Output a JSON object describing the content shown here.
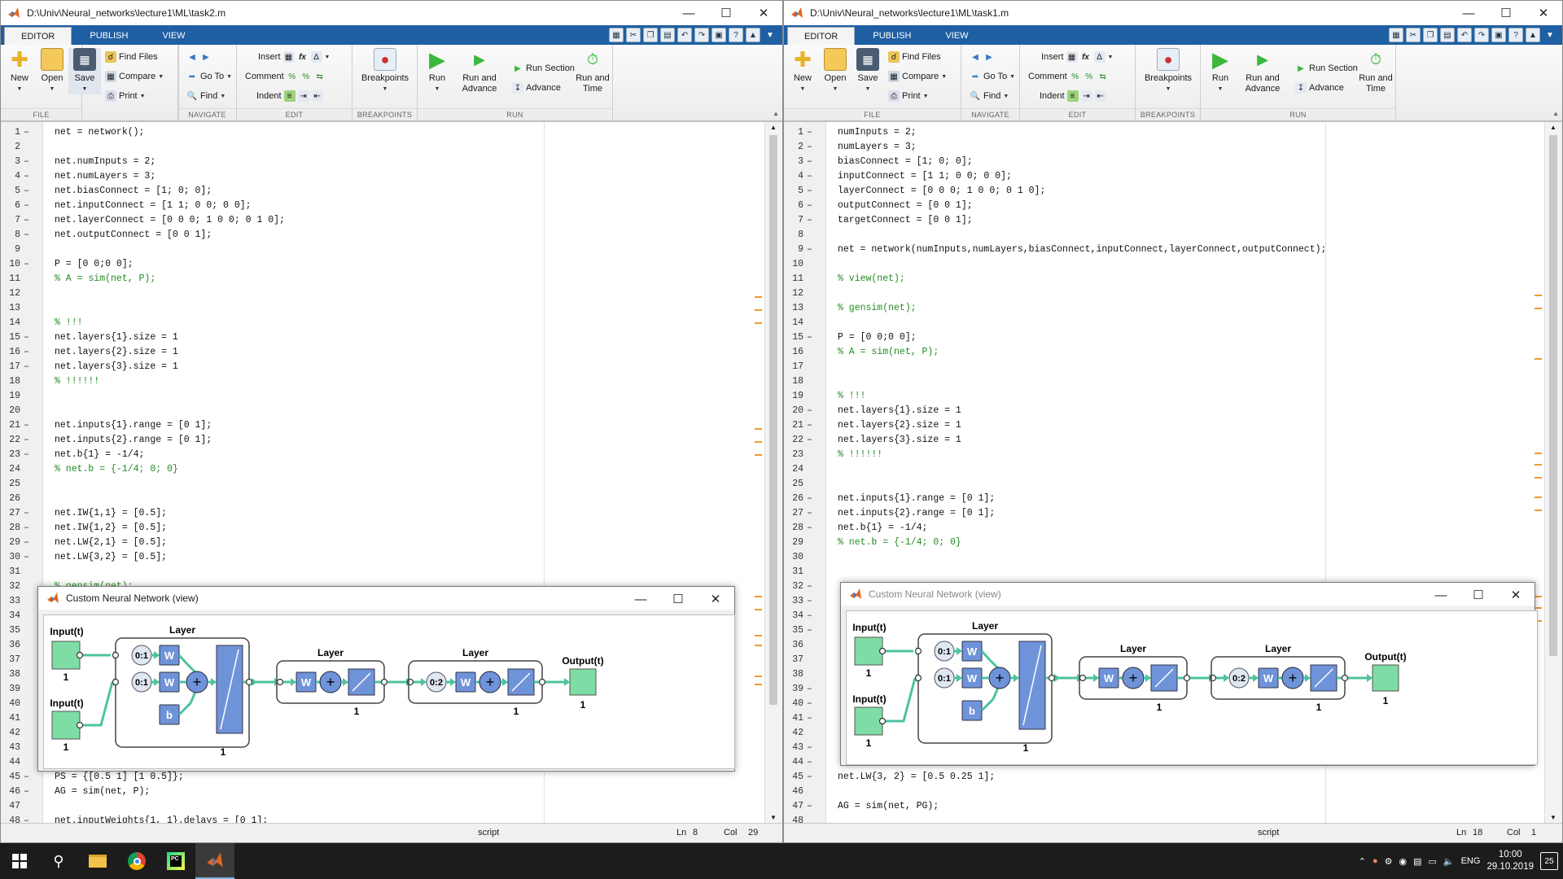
{
  "left": {
    "title": "D:\\Univ\\Neural_networks\\lecture1\\ML\\task2.m",
    "status": {
      "mode": "script",
      "ln_label": "Ln",
      "ln": "8",
      "col_label": "Col",
      "col": "29"
    },
    "lines": [
      {
        "n": "1",
        "d": "–",
        "t": "net = network();",
        "c": false
      },
      {
        "n": "2",
        "d": "",
        "t": "",
        "c": false
      },
      {
        "n": "3",
        "d": "–",
        "t": "net.numInputs = 2;",
        "c": false
      },
      {
        "n": "4",
        "d": "–",
        "t": "net.numLayers = 3;",
        "c": false
      },
      {
        "n": "5",
        "d": "–",
        "t": "net.biasConnect = [1; 0; 0];",
        "c": false
      },
      {
        "n": "6",
        "d": "–",
        "t": "net.inputConnect = [1 1; 0 0; 0 0];",
        "c": false
      },
      {
        "n": "7",
        "d": "–",
        "t": "net.layerConnect = [0 0 0; 1 0 0; 0 1 0];",
        "c": false
      },
      {
        "n": "8",
        "d": "–",
        "t": "net.outputConnect = [0 0 1];",
        "c": false
      },
      {
        "n": "9",
        "d": "",
        "t": "",
        "c": false
      },
      {
        "n": "10",
        "d": "–",
        "t": "P = [0 0;0 0];",
        "c": false
      },
      {
        "n": "11",
        "d": "",
        "t": "% A = sim(net, P);",
        "c": true
      },
      {
        "n": "12",
        "d": "",
        "t": "",
        "c": false
      },
      {
        "n": "13",
        "d": "",
        "t": "",
        "c": false
      },
      {
        "n": "14",
        "d": "",
        "t": "% !!!",
        "c": true
      },
      {
        "n": "15",
        "d": "–",
        "t": "net.layers{1}.size = 1",
        "c": false
      },
      {
        "n": "16",
        "d": "–",
        "t": "net.layers{2}.size = 1",
        "c": false
      },
      {
        "n": "17",
        "d": "–",
        "t": "net.layers{3}.size = 1",
        "c": false
      },
      {
        "n": "18",
        "d": "",
        "t": "% !!!!!!",
        "c": true
      },
      {
        "n": "19",
        "d": "",
        "t": "",
        "c": false
      },
      {
        "n": "20",
        "d": "",
        "t": "",
        "c": false
      },
      {
        "n": "21",
        "d": "–",
        "t": "net.inputs{1}.range = [0 1];",
        "c": false
      },
      {
        "n": "22",
        "d": "–",
        "t": "net.inputs{2}.range = [0 1];",
        "c": false
      },
      {
        "n": "23",
        "d": "–",
        "t": "net.b{1} = -1/4;",
        "c": false
      },
      {
        "n": "24",
        "d": "",
        "t": "% net.b = {-1/4; 0; 0}",
        "c": true
      },
      {
        "n": "25",
        "d": "",
        "t": "",
        "c": false
      },
      {
        "n": "26",
        "d": "",
        "t": "",
        "c": false
      },
      {
        "n": "27",
        "d": "–",
        "t": "net.IW{1,1} = [0.5];",
        "c": false
      },
      {
        "n": "28",
        "d": "–",
        "t": "net.IW{1,2} = [0.5];",
        "c": false
      },
      {
        "n": "29",
        "d": "–",
        "t": "net.LW{2,1} = [0.5];",
        "c": false
      },
      {
        "n": "30",
        "d": "–",
        "t": "net.LW{3,2} = [0.5];",
        "c": false
      },
      {
        "n": "31",
        "d": "",
        "t": "",
        "c": false
      },
      {
        "n": "32",
        "d": "",
        "t": "% gensim(net);",
        "c": true
      },
      {
        "n": "33",
        "d": "",
        "t": "",
        "c": false
      },
      {
        "n": "34",
        "d": "",
        "t": "",
        "c": false
      },
      {
        "n": "35",
        "d": "",
        "t": "",
        "c": false
      },
      {
        "n": "36",
        "d": "",
        "t": "",
        "c": false
      },
      {
        "n": "37",
        "d": "",
        "t": "",
        "c": false
      },
      {
        "n": "38",
        "d": "",
        "t": "",
        "c": false
      },
      {
        "n": "39",
        "d": "",
        "t": "",
        "c": false
      },
      {
        "n": "40",
        "d": "",
        "t": "",
        "c": false
      },
      {
        "n": "41",
        "d": "",
        "t": "",
        "c": false
      },
      {
        "n": "42",
        "d": "",
        "t": "",
        "c": false
      },
      {
        "n": "43",
        "d": "",
        "t": "",
        "c": false
      },
      {
        "n": "44",
        "d": "",
        "t": "",
        "c": false
      },
      {
        "n": "45",
        "d": "–",
        "t": "PS = {[0.5 1] [1 0.5]};",
        "c": false
      },
      {
        "n": "46",
        "d": "–",
        "t": "AG = sim(net, P);",
        "c": false
      },
      {
        "n": "47",
        "d": "",
        "t": "",
        "c": false
      },
      {
        "n": "48",
        "d": "–",
        "t": "net.inputWeights{1, 1}.delays = [0 1];",
        "c": false
      }
    ]
  },
  "right": {
    "title": "D:\\Univ\\Neural_networks\\lecture1\\ML\\task1.m",
    "status": {
      "mode": "script",
      "ln_label": "Ln",
      "ln": "18",
      "col_label": "Col",
      "col": "1"
    },
    "lines": [
      {
        "n": "1",
        "d": "–",
        "t": "numInputs = 2;",
        "c": false
      },
      {
        "n": "2",
        "d": "–",
        "t": "numLayers = 3;",
        "c": false
      },
      {
        "n": "3",
        "d": "–",
        "t": "biasConnect = [1; 0; 0];",
        "c": false
      },
      {
        "n": "4",
        "d": "–",
        "t": "inputConnect = [1 1; 0 0; 0 0];",
        "c": false
      },
      {
        "n": "5",
        "d": "–",
        "t": "layerConnect = [0 0 0; 1 0 0; 0 1 0];",
        "c": false
      },
      {
        "n": "6",
        "d": "–",
        "t": "outputConnect = [0 0 1];",
        "c": false
      },
      {
        "n": "7",
        "d": "–",
        "t": "targetConnect = [0 0 1];",
        "c": false
      },
      {
        "n": "8",
        "d": "",
        "t": "",
        "c": false
      },
      {
        "n": "9",
        "d": "–",
        "t": "net = network(numInputs,numLayers,biasConnect,inputConnect,layerConnect,outputConnect);",
        "c": false
      },
      {
        "n": "10",
        "d": "",
        "t": "",
        "c": false
      },
      {
        "n": "11",
        "d": "",
        "t": "% view(net);",
        "c": true
      },
      {
        "n": "12",
        "d": "",
        "t": "",
        "c": false
      },
      {
        "n": "13",
        "d": "",
        "t": "% gensim(net);",
        "c": true
      },
      {
        "n": "14",
        "d": "",
        "t": "",
        "c": false
      },
      {
        "n": "15",
        "d": "–",
        "t": "P = [0 0;0 0];",
        "c": false
      },
      {
        "n": "16",
        "d": "",
        "t": "% A = sim(net, P);",
        "c": true
      },
      {
        "n": "17",
        "d": "",
        "t": "",
        "c": false
      },
      {
        "n": "18",
        "d": "",
        "t": "",
        "c": false
      },
      {
        "n": "19",
        "d": "",
        "t": "% !!!",
        "c": true
      },
      {
        "n": "20",
        "d": "–",
        "t": "net.layers{1}.size = 1",
        "c": false
      },
      {
        "n": "21",
        "d": "–",
        "t": "net.layers{2}.size = 1",
        "c": false
      },
      {
        "n": "22",
        "d": "–",
        "t": "net.layers{3}.size = 1",
        "c": false
      },
      {
        "n": "23",
        "d": "",
        "t": "% !!!!!!",
        "c": true
      },
      {
        "n": "24",
        "d": "",
        "t": "",
        "c": false
      },
      {
        "n": "25",
        "d": "",
        "t": "",
        "c": false
      },
      {
        "n": "26",
        "d": "–",
        "t": "net.inputs{1}.range = [0 1];",
        "c": false
      },
      {
        "n": "27",
        "d": "–",
        "t": "net.inputs{2}.range = [0 1];",
        "c": false
      },
      {
        "n": "28",
        "d": "–",
        "t": "net.b{1} = -1/4;",
        "c": false
      },
      {
        "n": "29",
        "d": "",
        "t": "% net.b = {-1/4; 0; 0}",
        "c": true
      },
      {
        "n": "30",
        "d": "",
        "t": "",
        "c": false
      },
      {
        "n": "31",
        "d": "",
        "t": "",
        "c": false
      },
      {
        "n": "32",
        "d": "–",
        "t": "",
        "c": false
      },
      {
        "n": "33",
        "d": "–",
        "t": "",
        "c": false
      },
      {
        "n": "34",
        "d": "–",
        "t": "",
        "c": false
      },
      {
        "n": "35",
        "d": "–",
        "t": "",
        "c": false
      },
      {
        "n": "36",
        "d": "",
        "t": "",
        "c": false
      },
      {
        "n": "37",
        "d": "",
        "t": "",
        "c": false
      },
      {
        "n": "38",
        "d": "",
        "t": "",
        "c": false
      },
      {
        "n": "39",
        "d": "–",
        "t": "",
        "c": false
      },
      {
        "n": "40",
        "d": "–",
        "t": "",
        "c": false
      },
      {
        "n": "41",
        "d": "–",
        "t": "",
        "c": false
      },
      {
        "n": "42",
        "d": "",
        "t": "",
        "c": false
      },
      {
        "n": "43",
        "d": "–",
        "t": "",
        "c": false
      },
      {
        "n": "44",
        "d": "–",
        "t": "",
        "c": false
      },
      {
        "n": "45",
        "d": "–",
        "t": "net.LW{3, 2} = [0.5 0.25 1];",
        "c": false
      },
      {
        "n": "46",
        "d": "",
        "t": "",
        "c": false
      },
      {
        "n": "47",
        "d": "–",
        "t": "AG = sim(net, PG);",
        "c": false
      },
      {
        "n": "48",
        "d": "",
        "t": "",
        "c": false
      }
    ]
  },
  "ribbon": {
    "tabs": [
      "EDITOR",
      "PUBLISH",
      "VIEW"
    ],
    "new": "New",
    "open": "Open",
    "save": "Save",
    "find_files": "Find Files",
    "compare": "Compare",
    "print": "Print",
    "go_to": "Go To",
    "find": "Find",
    "insert": "Insert",
    "comment": "Comment",
    "indent": "Indent",
    "breakpoints": "Breakpoints",
    "run": "Run",
    "run_and_advance": "Run and Advance",
    "run_section": "Run Section",
    "advance": "Advance",
    "run_and_time": "Run and Time",
    "sections": [
      "FILE",
      "NAVIGATE",
      "EDIT",
      "BREAKPOINTS",
      "RUN"
    ]
  },
  "nnview": {
    "title": "Custom Neural Network (view)",
    "input_label": "Input(t)",
    "output_label": "Output(t)",
    "layer_label": "Layer",
    "w": "W",
    "b": "b",
    "delay1": "0:1",
    "delay2": "0:2",
    "one": "1"
  },
  "taskbar": {
    "lang": "ENG",
    "time": "10:00",
    "date": "29.10.2019",
    "notif_count": "25"
  },
  "colors": {
    "accent": "#1f5fa3",
    "block_blue": "#6f93d8",
    "input_green": "#7fdca4",
    "wire_green": "#4dc3a0",
    "comment_green": "#228b22",
    "mark_orange": "#f29a2e"
  }
}
